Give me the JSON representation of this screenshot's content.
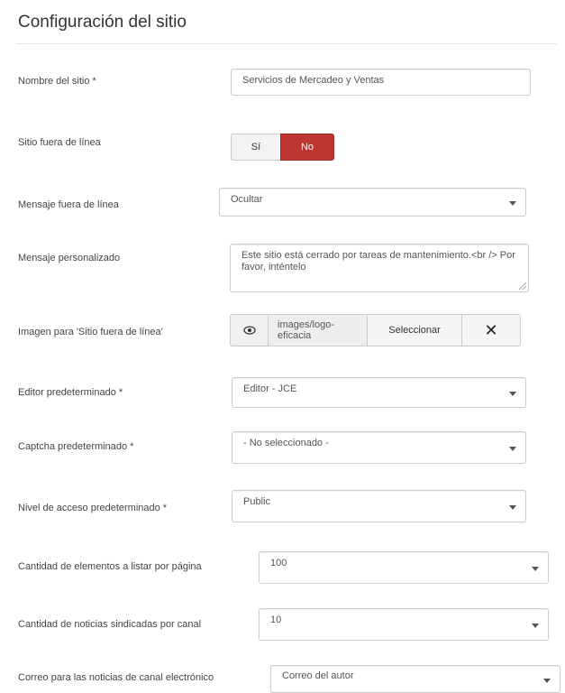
{
  "section": {
    "title": "Configuración del sitio"
  },
  "fields": {
    "site_name": {
      "label": "Nombre del sitio *",
      "value": "Servicios de Mercadeo y Ventas"
    },
    "offline": {
      "label": "Sitio fuera de línea",
      "yes_label": "Sí",
      "no_label": "No",
      "selected": "No"
    },
    "offline_message": {
      "label": "Mensaje fuera de línea",
      "value": "Ocultar"
    },
    "custom_message": {
      "label": "Mensaje personalizado",
      "value": "Este sitio está cerrado por tareas de mantenimiento.<br /> Por favor, inténtelo"
    },
    "offline_image": {
      "label": "Imagen para 'Sitio fuera de línea'",
      "path": "images/logo-eficacia",
      "select_label": "Seleccionar",
      "clear_icon": "close-icon",
      "preview_icon": "eye-icon"
    },
    "default_editor": {
      "label": "Editor predeterminado *",
      "value": "Editor - JCE"
    },
    "default_captcha": {
      "label": "Captcha predeterminado *",
      "value": "- No seleccionado -"
    },
    "default_access": {
      "label": "Nivel de acceso predeterminado *",
      "value": "Public"
    },
    "list_limit": {
      "label": "Cantidad de elementos a listar por página",
      "value": "100"
    },
    "feed_limit": {
      "label": "Cantidad de noticias sindicadas por canal",
      "value": "10"
    },
    "feed_email": {
      "label": "Correo para las noticias de canal electrónico",
      "value": "Correo del autor"
    }
  },
  "colors": {
    "no_active": "#bd362f",
    "border": "#cccccc"
  }
}
